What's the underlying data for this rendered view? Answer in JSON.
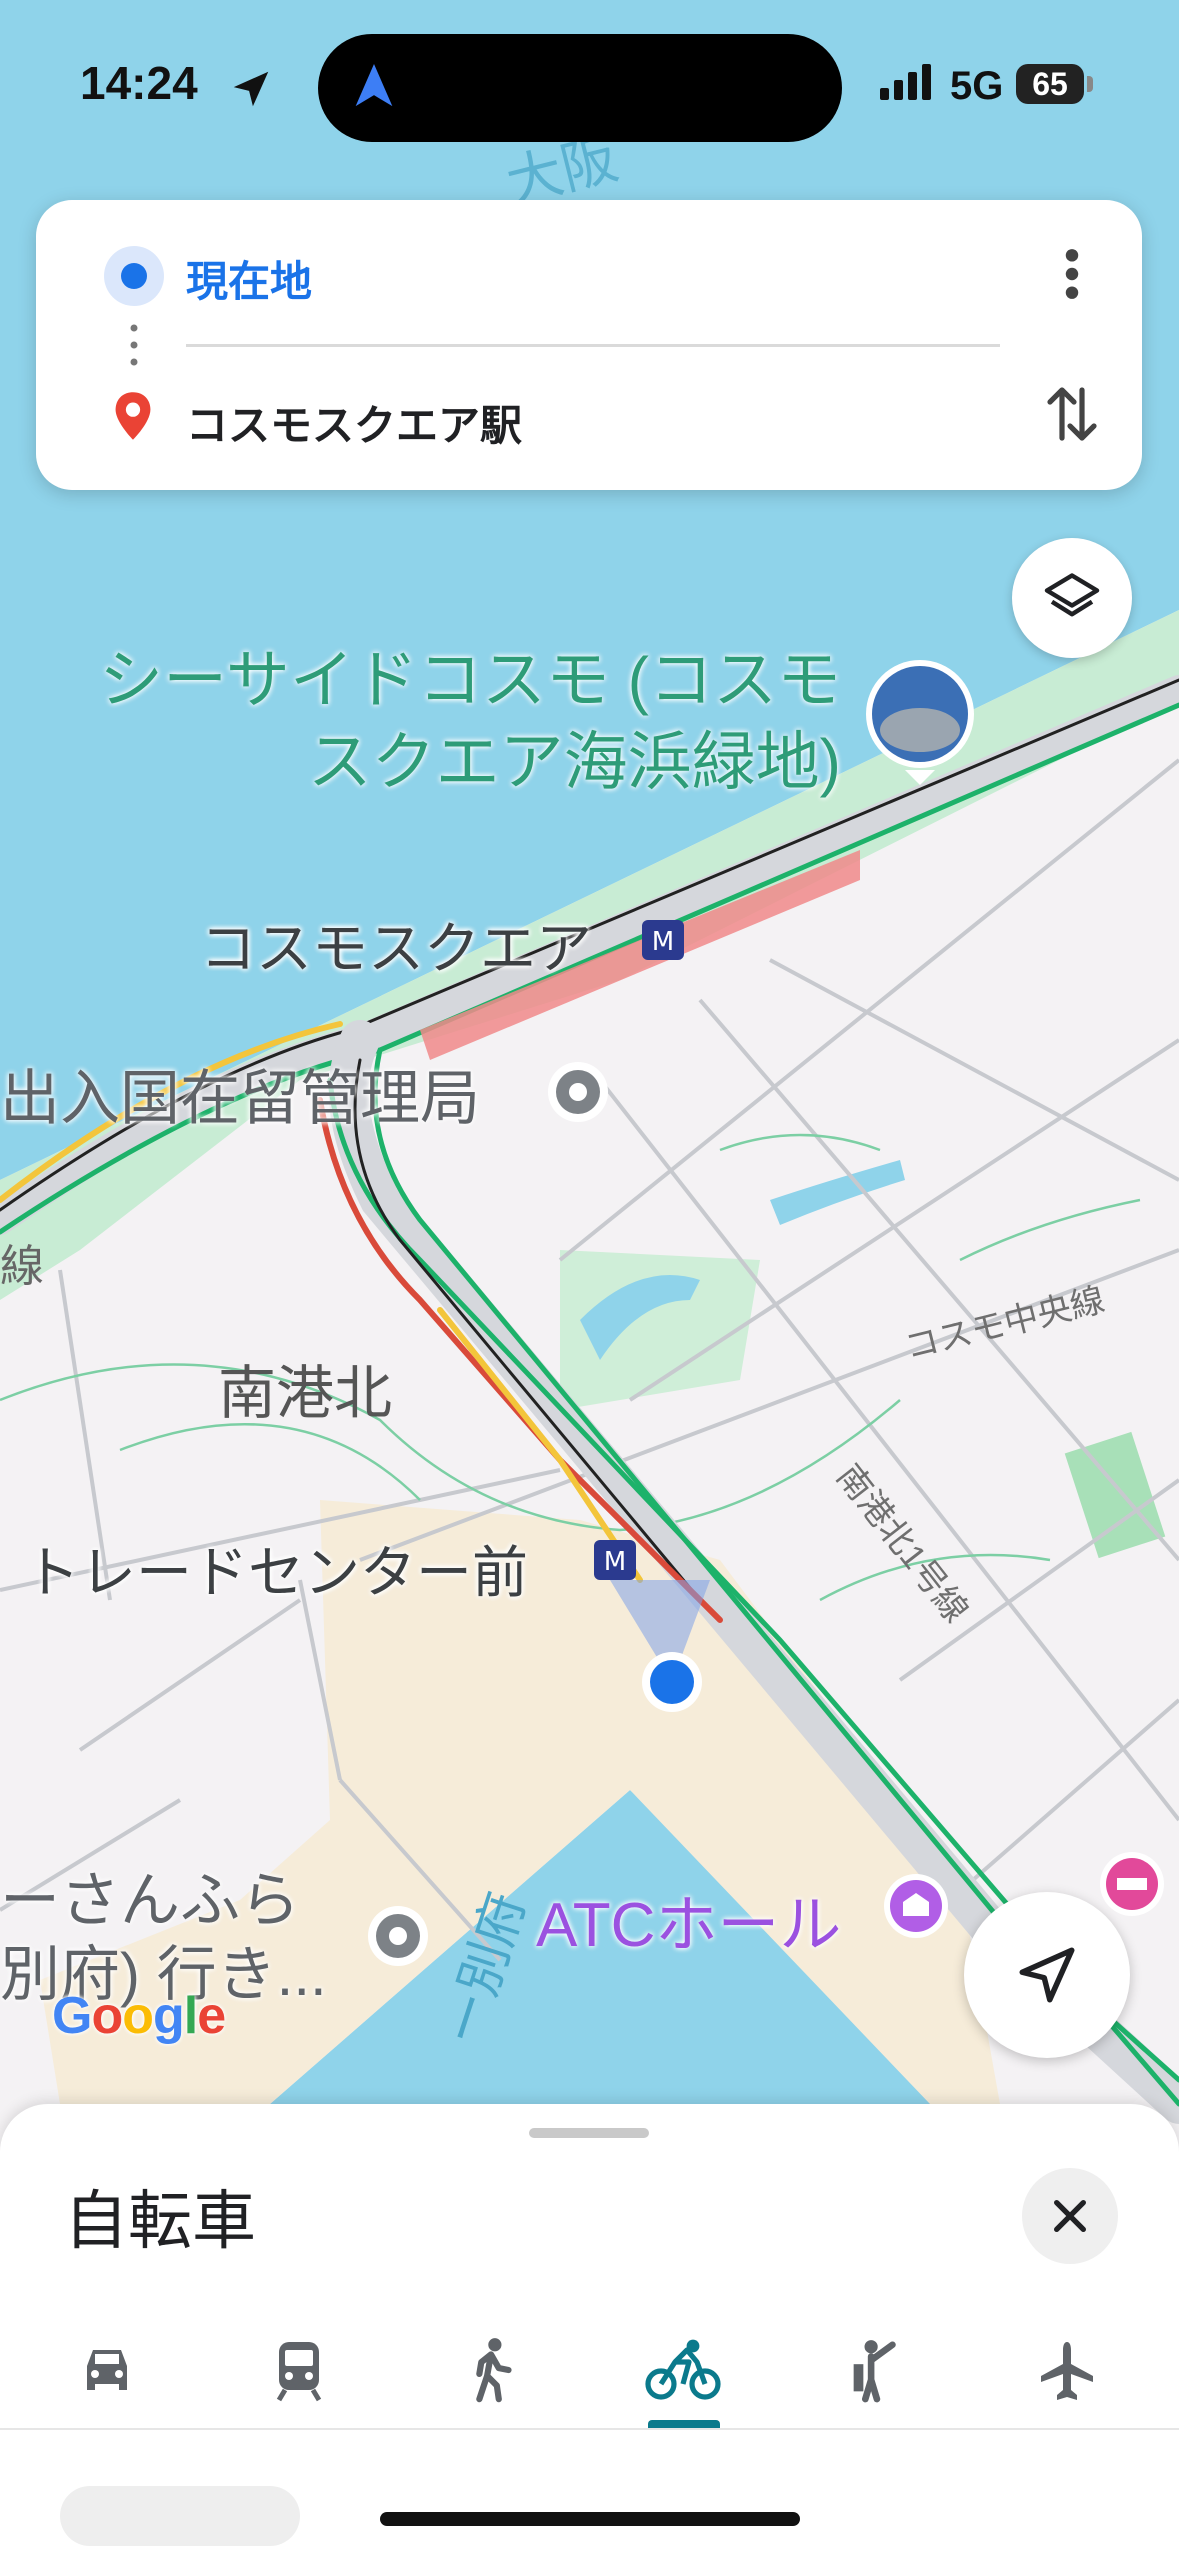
{
  "status_bar": {
    "time": "14:24",
    "network": "5G",
    "battery": "65"
  },
  "route": {
    "origin": "現在地",
    "destination": "コスモスクエア駅"
  },
  "map": {
    "park_label_line1": "シーサイドコスモ (コスモ",
    "park_label_line2": "スクエア海浜緑地)",
    "station_cosmosquare": "コスモスクエア",
    "immigration": "出入国在留管理局",
    "district": "南港北",
    "station_trade_center": "トレードセンター前",
    "road_cosmo_chuo": "コスモ中央線",
    "road_nanko_kita": "南港北1号線",
    "atc_hall": "ATCホール",
    "ferry_line1": "ーさんふら",
    "ferry_line2": "別府) 行き...",
    "water_label_top": "大阪",
    "water_label_bottom": "ー別府",
    "rail_fragment": "線",
    "attribution": "Google"
  },
  "sheet": {
    "title": "自転車",
    "modes": [
      "car",
      "transit",
      "walk",
      "bicycle",
      "ride",
      "flight"
    ],
    "selected_mode": "bicycle"
  },
  "colors": {
    "water": "#8fd3ea",
    "land": "#f4f2f4",
    "green": "#c7ecd3",
    "accent": "#1a73e8",
    "mode_selected": "#0b7a8c",
    "atc": "#9b51e0",
    "rail_red": "#f08a8a"
  },
  "icons": {
    "layers": "layers-icon",
    "locate": "navigation-arrow-icon",
    "close": "close-icon",
    "swap": "swap-vertical-icon",
    "more": "more-vertical-icon"
  }
}
